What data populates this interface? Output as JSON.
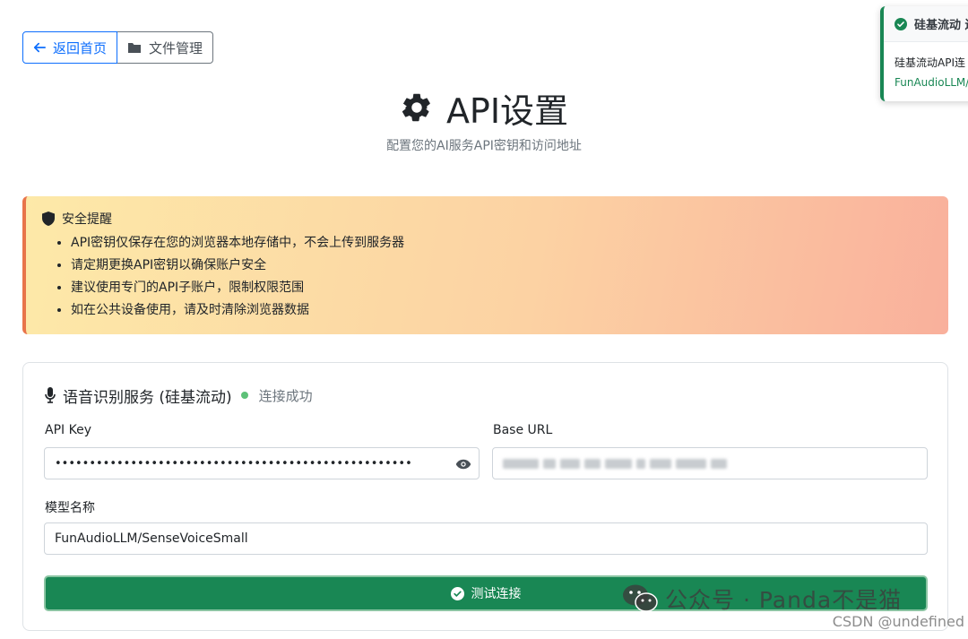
{
  "nav": {
    "back_label": "返回首页",
    "files_label": "文件管理"
  },
  "header": {
    "title": "API设置",
    "subtitle": "配置您的AI服务API密钥和访问地址"
  },
  "alert": {
    "title": "安全提醒",
    "items": [
      "API密钥仅保存在您的浏览器本地存储中，不会上传到服务器",
      "请定期更换API密钥以确保账户安全",
      "建议使用专门的API子账户，限制权限范围",
      "如在公共设备使用，请及时清除浏览器数据"
    ]
  },
  "service": {
    "title": "语音识别服务 (硅基流动)",
    "status": "连接成功",
    "api_key_label": "API Key",
    "api_key_value": "••••••••••••••••••••••••••••••••••••••••••••••••••••",
    "base_url_label": "Base URL",
    "model_label": "模型名称",
    "model_value": "FunAudioLLM/SenseVoiceSmall",
    "test_label": "测试连接"
  },
  "toast": {
    "title": "硅基流动 连",
    "line1": "硅基流动API连",
    "line2": "FunAudioLLM/"
  },
  "watermark": {
    "text": "公众号 · Panda不是猫",
    "csdn": "CSDN @undefined"
  },
  "colors": {
    "primary": "#0d6efd",
    "success": "#198754",
    "status_dot": "#5dc178"
  }
}
